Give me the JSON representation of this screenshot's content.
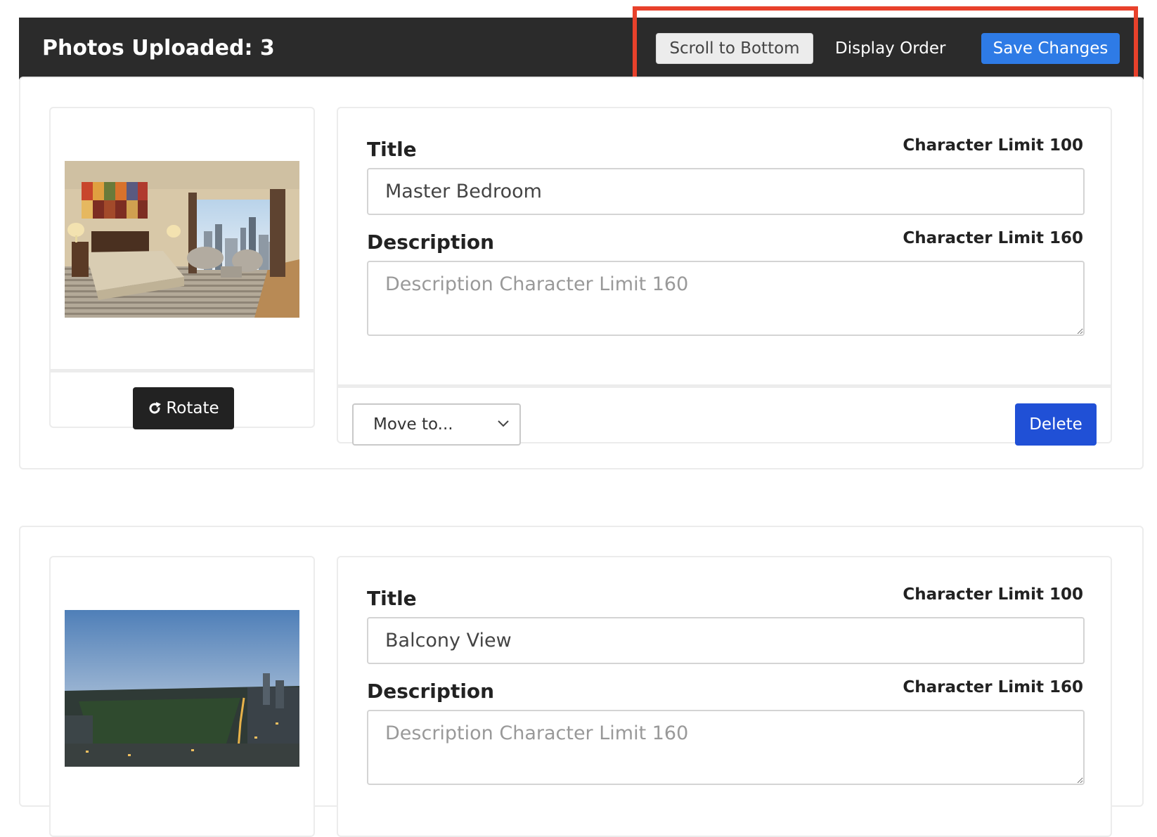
{
  "header": {
    "title": "Photos Uploaded: 3",
    "scroll_label": "Scroll to Bottom",
    "order_label": "Display Order",
    "save_label": "Save Changes",
    "highlight_color": "#e8412b"
  },
  "labels": {
    "title": "Title",
    "title_limit": "Character Limit 100",
    "description": "Description",
    "description_limit": "Character Limit 160",
    "description_placeholder": "Description Character Limit 160",
    "rotate": "Rotate",
    "move_to": "Move to...",
    "delete": "Delete"
  },
  "photos": [
    {
      "title_value": "Master Bedroom",
      "description_value": "",
      "image": "bedroom-photo"
    },
    {
      "title_value": "Balcony View",
      "description_value": "",
      "image": "city-skyline-photo"
    }
  ],
  "colors": {
    "header_bg": "#2b2b2b",
    "save_button": "#2e7be6",
    "delete_button": "#2050d6",
    "rotate_button": "#222222"
  }
}
